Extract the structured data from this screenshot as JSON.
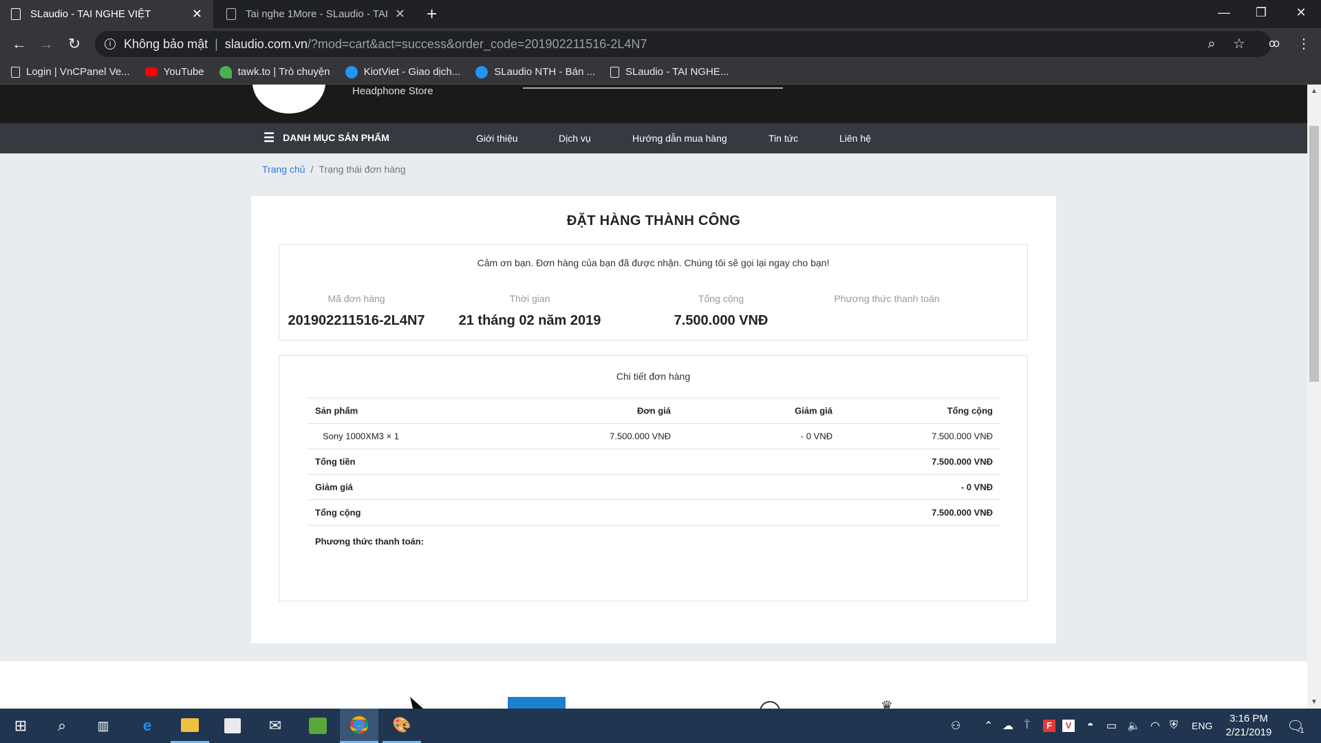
{
  "browser": {
    "tabs": [
      {
        "label": "SLaudio - TAI NGHE VIỆT",
        "active": true
      },
      {
        "label": "Tai nghe 1More - SLaudio - TAI N",
        "active": false
      }
    ],
    "security_label": "Không bảo mật",
    "url_host": "slaudio.com.vn",
    "url_path": "/?mod=cart&act=success&order_code=201902211516-2L4N7",
    "bookmarks": [
      {
        "label": "Login | VnCPanel Ve...",
        "icon": "page-icon",
        "color": "#e8eaed"
      },
      {
        "label": "YouTube",
        "icon": "youtube-icon",
        "color": "#ff0000"
      },
      {
        "label": "tawk.to | Trò chuyện",
        "icon": "tawk-icon",
        "color": "#4caf50"
      },
      {
        "label": "KiotViet - Giao dịch...",
        "icon": "kiotviet-icon",
        "color": "#2196f3"
      },
      {
        "label": "SLaudio NTH - Bán ...",
        "icon": "kiotviet-icon",
        "color": "#2196f3"
      },
      {
        "label": "SLaudio - TAI NGHE...",
        "icon": "page-icon",
        "color": "#e8eaed"
      }
    ]
  },
  "site": {
    "tagline": "Headphone Store",
    "category_label": "DANH MỤC SẢN PHẨM",
    "nav": [
      "Giới thiệu",
      "Dịch vụ",
      "Hướng dẫn mua hàng",
      "Tin tức",
      "Liên hệ"
    ],
    "breadcrumb": {
      "home": "Trang chủ",
      "separator": "/",
      "current": "Trạng thái đơn hàng"
    }
  },
  "order": {
    "title": "ĐẶT HÀNG THÀNH CÔNG",
    "thanks": "Cảm ơn bạn. Đơn hàng của bạn đã được nhận. Chúng tôi sẽ gọi lại ngay cho bạn!",
    "summary": [
      {
        "label": "Mã đơn hàng",
        "value": "201902211516-2L4N7"
      },
      {
        "label": "Thời gian",
        "value": "21 tháng 02 năm 2019"
      },
      {
        "label": "Tổng cộng",
        "value": "7.500.000 VNĐ"
      },
      {
        "label": "Phương thức thanh toán",
        "value": ""
      }
    ],
    "detail_title": "Chi tiết đơn hàng",
    "columns": [
      "Sản phẩm",
      "Đơn giá",
      "Giảm giá",
      "Tổng cộng"
    ],
    "items": [
      {
        "product": "Sony 1000XM3 × 1",
        "unit_price": "7.500.000 VNĐ",
        "discount": "- 0 VNĐ",
        "total": "7.500.000 VNĐ"
      }
    ],
    "subtotal": {
      "label": "Tổng tiền",
      "value": "7.500.000 VNĐ"
    },
    "discount": {
      "label": "Giảm giá",
      "value": "- 0 VNĐ"
    },
    "grand_total": {
      "label": "Tổng cộng",
      "value": "7.500.000 VNĐ"
    },
    "payment": {
      "label": "Phương thức thanh toán:",
      "value": ""
    }
  },
  "taskbar": {
    "language": "ENG",
    "time": "3:16 PM",
    "date": "2/21/2019",
    "notification_count": "1"
  }
}
